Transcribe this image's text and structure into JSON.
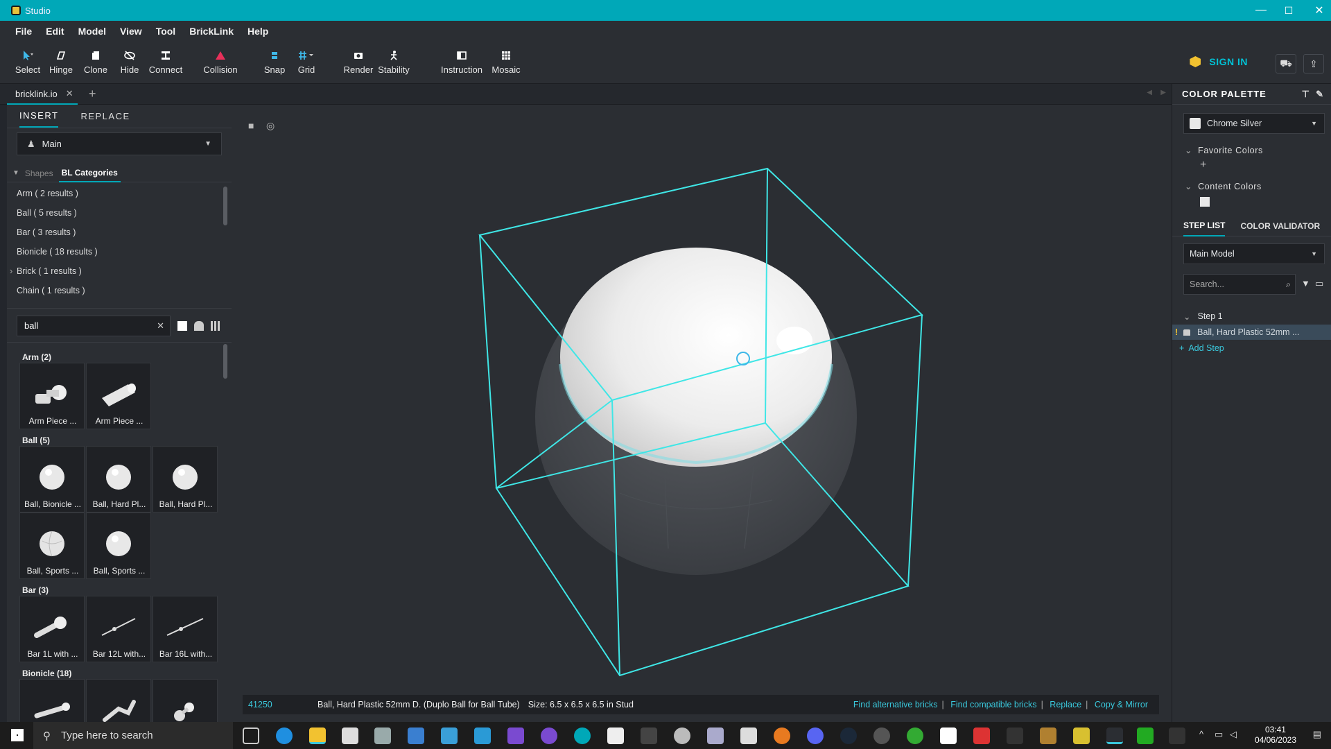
{
  "window": {
    "title": "Studio",
    "minimize": "—",
    "maximize": "☐",
    "close": "✕"
  },
  "menu": [
    "File",
    "Edit",
    "Model",
    "View",
    "Tool",
    "BrickLink",
    "Help"
  ],
  "toolbar": {
    "tools": [
      {
        "label": "Select",
        "icon": "cursor-icon"
      },
      {
        "label": "Hinge",
        "icon": "hinge-icon"
      },
      {
        "label": "Clone",
        "icon": "clone-icon"
      },
      {
        "label": "Hide",
        "icon": "hide-icon"
      },
      {
        "label": "Connect",
        "icon": "connect-icon"
      },
      {
        "label": "Collision",
        "icon": "collision-icon"
      },
      {
        "label": "Snap",
        "icon": "snap-icon"
      },
      {
        "label": "Grid",
        "icon": "grid-icon"
      },
      {
        "label": "Render",
        "icon": "camera-icon"
      },
      {
        "label": "Stability",
        "icon": "stability-icon"
      },
      {
        "label": "Instruction",
        "icon": "instruction-icon"
      },
      {
        "label": "Mosaic",
        "icon": "mosaic-icon"
      }
    ],
    "sign_in": "SIGN IN"
  },
  "doc_tab": {
    "label": "bricklink.io"
  },
  "left_panel": {
    "tabs": [
      "INSERT",
      "REPLACE"
    ],
    "palette_select": "Main",
    "shape_tabs": [
      "Shapes",
      "BL Categories"
    ],
    "categories": [
      "Arm ( 2 results )",
      "Ball ( 5 results )",
      "Bar ( 3 results )",
      "Bionicle ( 18 results )",
      "Brick ( 1 results )",
      "Chain ( 1 results )"
    ],
    "search_value": "ball",
    "groups": [
      {
        "title": "Arm (2)",
        "items": [
          "Arm Piece ...",
          "Arm Piece ..."
        ]
      },
      {
        "title": "Ball (5)",
        "items": [
          "Ball, Bionicle ...",
          "Ball, Hard Pl...",
          "Ball, Hard Pl...",
          "Ball, Sports ...",
          "Ball, Sports ..."
        ]
      },
      {
        "title": "Bar (3)",
        "items": [
          "Bar  1L with ...",
          "Bar  12L with...",
          "Bar  16L with..."
        ]
      },
      {
        "title": "Bionicle (18)",
        "items": [
          "",
          "",
          ""
        ]
      }
    ]
  },
  "status_bar": {
    "part_number": "41250",
    "description": "Ball, Hard Plastic 52mm D. (Duplo Ball for Ball Tube)",
    "size": "Size: 6.5 x 6.5 x 6.5 in Stud",
    "links": [
      "Find alternative bricks",
      "Find compatible bricks",
      "Replace",
      "Copy & Mirror"
    ]
  },
  "right_panel": {
    "color_palette_title": "COLOR PALETTE",
    "selected_color": "Chrome Silver",
    "favorite_colors": "Favorite Colors",
    "content_colors": "Content Colors",
    "tabs": [
      "STEP LIST",
      "COLOR VALIDATOR"
    ],
    "model_select": "Main Model",
    "search_placeholder": "Search...",
    "step": "Step 1",
    "step_item": "Ball, Hard Plastic 52mm ...",
    "add_step": "Add Step"
  },
  "taskbar": {
    "search_placeholder": "Type here to search",
    "time": "03:41",
    "date": "04/06/2023"
  },
  "colors": {
    "accent": "#00a8b8",
    "selection": "#3fe6e6",
    "link": "#3ac8dc"
  }
}
